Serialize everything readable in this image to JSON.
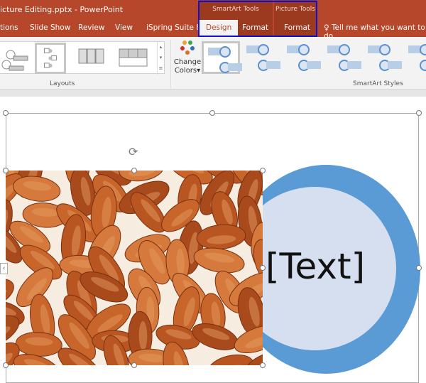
{
  "window": {
    "title": "icture Editing.pptx  -  PowerPoint"
  },
  "context_groups": {
    "smartart": "SmartArt Tools",
    "picture": "Picture Tools"
  },
  "tabs": [
    {
      "label": "tions"
    },
    {
      "label": "Slide Show"
    },
    {
      "label": "Review"
    },
    {
      "label": "View"
    },
    {
      "label": "iSpring Suite 8"
    },
    {
      "label": "Design",
      "active": true
    },
    {
      "label": "Format"
    },
    {
      "label": "Format"
    }
  ],
  "tell_me": "Tell me what you want to do",
  "ribbon": {
    "layouts_label": "Layouts",
    "change_colors_line1": "Change",
    "change_colors_line2": "Colors",
    "styles_label": "SmartArt Styles"
  },
  "slide": {
    "shape_text": "[Text]"
  },
  "colors": {
    "accent": "#b7472a",
    "circle_outer": "#5b9bd5",
    "circle_inner": "#d6dff0",
    "highlight": "#1010d0"
  }
}
